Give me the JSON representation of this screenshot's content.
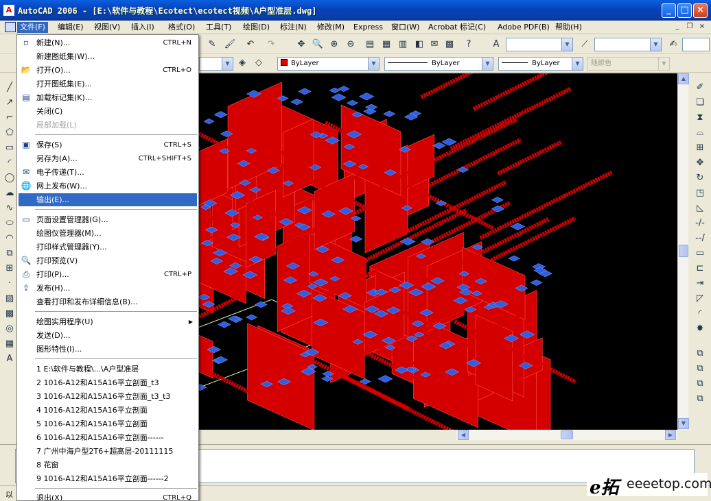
{
  "window": {
    "title": "AutoCAD 2006 - [E:\\软件与教程\\Ecotect\\ecotect视频\\A户型准层.dwg]",
    "app_icon": "autocad-logo-icon",
    "controls": [
      "minimize-icon",
      "maximize-icon",
      "close-icon"
    ]
  },
  "menubar": {
    "items": [
      "文件(F)",
      "编辑(E)",
      "视图(V)",
      "插入(I)",
      "格式(O)",
      "工具(T)",
      "绘图(D)",
      "标注(N)",
      "修改(M)",
      "Express",
      "窗口(W)",
      "Acrobat 标记(C)",
      "Adobe PDF(B)",
      "帮助(H)"
    ],
    "active_index": 0
  },
  "properties_toolbar": {
    "color": "ByLayer",
    "linetype": "ByLayer",
    "lineweight": "ByLayer",
    "plotstyle": "随颜色",
    "color_swatch": "#e00000"
  },
  "file_menu": {
    "items": [
      {
        "label": "新建(N)...",
        "shortcut": "CTRL+N",
        "icon": "new-file-icon"
      },
      {
        "label": "新建图纸集(W)...",
        "shortcut": "",
        "icon": ""
      },
      {
        "label": "打开(O)...",
        "shortcut": "CTRL+O",
        "icon": "open-folder-icon"
      },
      {
        "label": "打开图纸集(E)...",
        "shortcut": "",
        "icon": ""
      },
      {
        "label": "加载标记集(K)...",
        "shortcut": "",
        "icon": "markup-icon"
      },
      {
        "label": "关闭(C)",
        "shortcut": "",
        "icon": ""
      },
      {
        "label": "局部加载(L)",
        "shortcut": "",
        "icon": "",
        "disabled": true
      },
      {
        "label": "保存(S)",
        "shortcut": "CTRL+S",
        "icon": "save-disk-icon"
      },
      {
        "label": "另存为(A)...",
        "shortcut": "CTRL+SHIFT+S",
        "icon": ""
      },
      {
        "label": "电子传递(T)...",
        "shortcut": "",
        "icon": "etransmit-icon"
      },
      {
        "label": "网上发布(W)...",
        "shortcut": "",
        "icon": "publish-web-icon"
      },
      {
        "label": "输出(E)...",
        "shortcut": "",
        "icon": "",
        "highlighted": true
      },
      {
        "label": "页面设置管理器(G)...",
        "shortcut": "",
        "icon": "page-setup-icon"
      },
      {
        "label": "绘图仪管理器(M)...",
        "shortcut": "",
        "icon": ""
      },
      {
        "label": "打印样式管理器(Y)...",
        "shortcut": "",
        "icon": ""
      },
      {
        "label": "打印预览(V)",
        "shortcut": "",
        "icon": "print-preview-icon"
      },
      {
        "label": "打印(P)...",
        "shortcut": "CTRL+P",
        "icon": "print-icon"
      },
      {
        "label": "发布(H)...",
        "shortcut": "",
        "icon": "publish-icon"
      },
      {
        "label": "查看打印和发布详细信息(B)...",
        "shortcut": "",
        "icon": ""
      },
      {
        "label": "绘图实用程序(U)",
        "shortcut": "",
        "icon": "",
        "submenu": true
      },
      {
        "label": "发送(D)...",
        "shortcut": "",
        "icon": ""
      },
      {
        "label": "图形特性(I)...",
        "shortcut": "",
        "icon": ""
      },
      {
        "label": "1 E:\\软件与教程\\...\\A户型准层",
        "shortcut": "",
        "icon": ""
      },
      {
        "label": "2 1016-A12和A15A16平立剖面_t3",
        "shortcut": "",
        "icon": ""
      },
      {
        "label": "3 1016-A12和A15A16平立剖面_t3_t3",
        "shortcut": "",
        "icon": ""
      },
      {
        "label": "4 1016-A12和A15A16平立剖面",
        "shortcut": "",
        "icon": ""
      },
      {
        "label": "5 1016-A12和A15A16平立剖面",
        "shortcut": "",
        "icon": ""
      },
      {
        "label": "6 1016-A12和A15A16平立剖面------",
        "shortcut": "",
        "icon": ""
      },
      {
        "label": "7 广州中海户型2T6+超高层-20111115",
        "shortcut": "",
        "icon": ""
      },
      {
        "label": "8 花窗",
        "shortcut": "",
        "icon": ""
      },
      {
        "label": "9 1016-A12和A15A16平立剖面------2",
        "shortcut": "",
        "icon": ""
      },
      {
        "label": "退出(X)",
        "shortcut": "CTRL+Q",
        "icon": ""
      }
    ]
  },
  "status": {
    "text": "以"
  },
  "watermark": {
    "logo": "e拓",
    "text": "eeeetop.com"
  },
  "colors": {
    "titlebar": "#0a46c8",
    "menu_highlight": "#316ac5",
    "model_red": "#d40000",
    "model_blue": "#2f5fe0",
    "viewport_bg": "#000000"
  }
}
